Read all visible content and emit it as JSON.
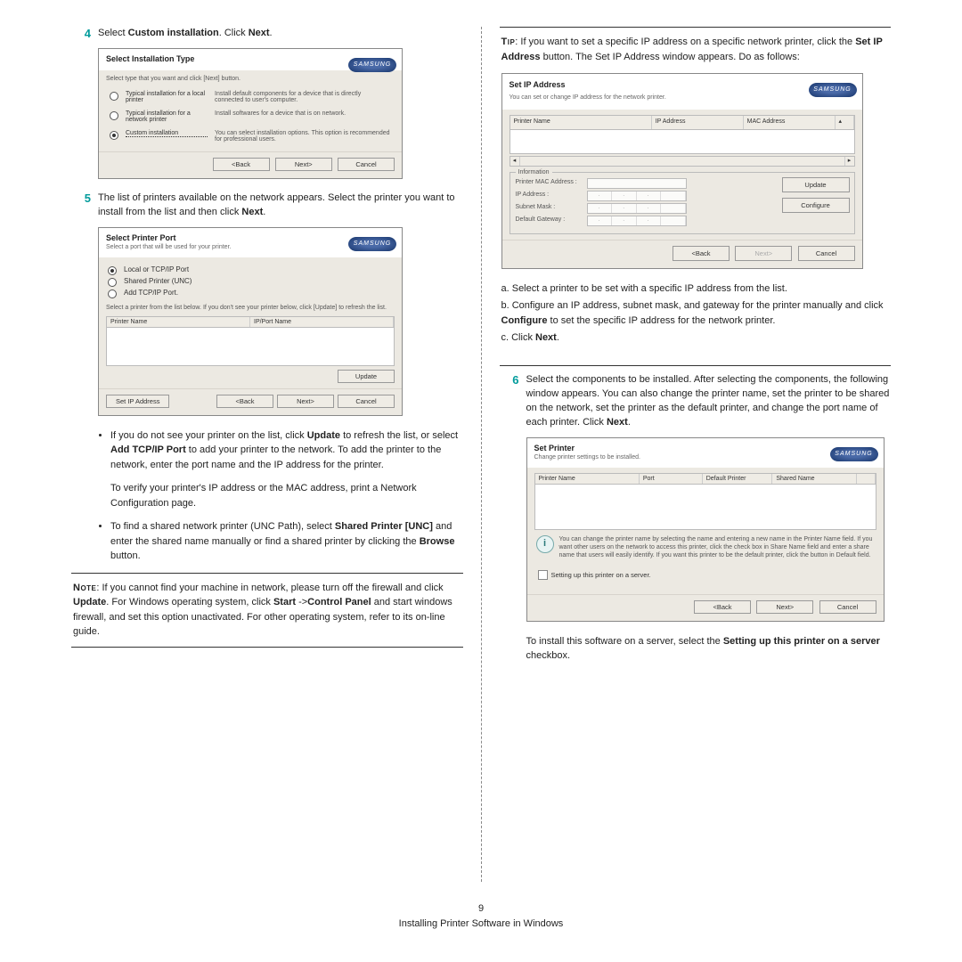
{
  "step4": {
    "num": "4",
    "text_a": "Select ",
    "text_b": "Custom installation",
    "text_c": ". Click ",
    "text_d": "Next",
    "text_e": "."
  },
  "dlg1": {
    "title": "Select Installation Type",
    "brand": "SAMSUNG",
    "hint": "Select type that you want and click [Next] button.",
    "opt1_label": "Typical installation for a local printer",
    "opt1_desc": "Install default components for a device that is directly connected to user's computer.",
    "opt2_label": "Typical installation for a network printer",
    "opt2_desc": "Install softwares for a device that is on network.",
    "opt3_label": "Custom installation",
    "opt3_desc": "You can select installation options. This option is recommended for professional users.",
    "back": "<Back",
    "next": "Next>",
    "cancel": "Cancel"
  },
  "step5": {
    "num": "5",
    "text_a": "The list of printers available on the network appears. Select the printer you want to install from the list and then click ",
    "text_b": "Next",
    "text_c": "."
  },
  "dlg2": {
    "title": "Select Printer Port",
    "sub": "Select a port that will be used for your printer.",
    "r1": "Local or TCP/IP Port",
    "r2": "Shared Printer (UNC)",
    "r3": "Add TCP/IP Port.",
    "hint": "Select a printer from the list below. If you don't see your printer below, click [Update] to refresh the list.",
    "col1": "Printer Name",
    "col2": "IP/Port Name",
    "update": "Update",
    "setip": "Set IP Address",
    "back": "<Back",
    "next": "Next>",
    "cancel": "Cancel"
  },
  "bullets": {
    "b1_a": "If you do not see your printer on the list, click ",
    "b1_b": "Update",
    "b1_c": " to refresh the list, or select ",
    "b1_d": "Add TCP/IP Port",
    "b1_e": " to add your printer to the network. To add the printer to the network, enter the port name and the IP address for the printer.",
    "b1_f": "To verify your printer's IP address or the MAC address, print a Network Configuration page.",
    "b2_a": "To find a shared network printer (UNC Path), select ",
    "b2_b": "Shared Printer [UNC]",
    "b2_c": " and enter the shared name manually or find a shared printer by clicking the ",
    "b2_d": "Browse",
    "b2_e": " button."
  },
  "note": {
    "label": "Note",
    "text_a": ": If you cannot find your machine in network, please turn off the firewall and click ",
    "text_b": "Update",
    "text_c": ". For Windows operating system, click ",
    "text_d": "Start",
    "text_e": " ->",
    "text_f": "Control Panel",
    "text_g": " and start windows firewall, and set this option unactivated. For other operating system, refer to its on-line guide."
  },
  "tip": {
    "label": "Tip",
    "text_a": ": If you want to set a specific IP address on a specific network printer, click the ",
    "text_b": "Set IP Address",
    "text_c": " button. The Set IP Address window appears. Do as follows:"
  },
  "dlg3": {
    "title": "Set IP Address",
    "sub": "You can set or change IP address for the network printer.",
    "col1": "Printer Name",
    "col2": "IP Address",
    "col3": "MAC Address",
    "legend": "Information",
    "k1": "Printer MAC Address :",
    "k2": "IP Address :",
    "k3": "Subnet Mask :",
    "k4": "Default Gateway :",
    "update": "Update",
    "configure": "Configure",
    "back": "<Back",
    "next": "Next>",
    "cancel": "Cancel"
  },
  "sub": {
    "a": "a. Select a printer to be set with a specific IP address from the list.",
    "b_a": "b. Configure an IP address, subnet mask, and gateway for the printer manually and click ",
    "b_b": "Configure",
    "b_c": " to set the specific IP address for the network printer.",
    "c_a": "c. Click ",
    "c_b": "Next",
    "c_c": "."
  },
  "step6": {
    "num": "6",
    "text_a": "Select the components to be installed. After selecting the components, the following window appears. You can also change the printer name, set the printer to be shared on the network, set the printer as the default printer, and change the port name of each printer. Click ",
    "text_b": "Next",
    "text_c": "."
  },
  "dlg4": {
    "title": "Set Printer",
    "sub": "Change printer settings to be installed.",
    "col1": "Printer Name",
    "col2": "Port",
    "col3": "Default Printer",
    "col4": "Shared Name",
    "info": "You can change the printer name by selecting the name and entering a new name in the Printer Name field. If you want other users on the network to access this printer, click the check box in Share Name field and enter a share name that users will easily identify. If you want this printer to be the default printer, click the button in Default field.",
    "chk": "Setting up this printer on a server.",
    "back": "<Back",
    "next": "Next>",
    "cancel": "Cancel"
  },
  "tail": {
    "a": "To install this software on a server, select the ",
    "b": "Setting up this printer on a server",
    "c": " checkbox."
  },
  "footer": {
    "page": "9",
    "title": "Installing Printer Software in Windows"
  }
}
